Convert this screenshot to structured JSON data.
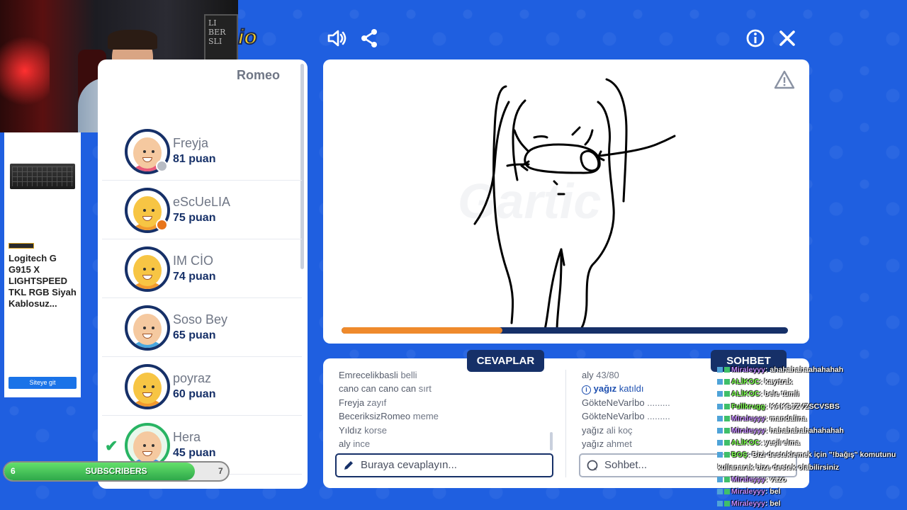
{
  "webcam": {
    "board_text": "LI BER SLI"
  },
  "ad": {
    "title": "Logitech G G915 X LIGHTSPEED TKL RGB Siyah Kablosuz...",
    "button": "Siteye git"
  },
  "logo": {
    "text": "io"
  },
  "players": {
    "partial_name": "Romeo",
    "list": [
      {
        "name": "Freyja",
        "score": "81 puan",
        "status": "gray",
        "shirt": "#e85a7a",
        "face": "#f5c9a0"
      },
      {
        "name": "eScUeLIA",
        "score": "75 puan",
        "status": "orange",
        "shirt": "#f29a2e",
        "face": "#f7c544"
      },
      {
        "name": "IM CİO",
        "score": "74 puan",
        "status": "",
        "shirt": "#f29a2e",
        "face": "#f7c544"
      },
      {
        "name": "Soso Bey",
        "score": "65 puan",
        "status": "",
        "shirt": "#4aa8e0",
        "face": "#f5c9a0"
      },
      {
        "name": "poyraz",
        "score": "60 puan",
        "status": "",
        "shirt": "#f29a2e",
        "face": "#f7c544"
      },
      {
        "name": "Hera",
        "score": "45 puan",
        "status": "",
        "shirt": "#3a8ee0",
        "face": "#f5c9a0",
        "guessed": true
      }
    ]
  },
  "canvas": {
    "watermark": "Gartic",
    "progress": 0.36
  },
  "tabs": {
    "answers": "CEVAPLAR",
    "chat": "SOHBET"
  },
  "answers": {
    "messages": [
      {
        "user": "Emrecelikbasli",
        "text": "belli"
      },
      {
        "user": "cano can cano can",
        "text": "sırt"
      },
      {
        "user": "Freyja",
        "text": "zayıf"
      },
      {
        "user": "BeceriksizRomeo",
        "text": "meme"
      },
      {
        "user": "Yıldız",
        "text": "korse"
      },
      {
        "user": "aly",
        "text": "ince"
      }
    ],
    "placeholder": "Buraya cevaplayın..."
  },
  "chat": {
    "messages": [
      {
        "user": "aly",
        "text": "43/80",
        "type": "normal"
      },
      {
        "user": "yağız",
        "text": "katıldı",
        "type": "join"
      },
      {
        "user": "GökteNeVarİbo",
        "text": ".........",
        "type": "normal"
      },
      {
        "user": "GökteNeVarİbo",
        "text": ".........",
        "type": "normal"
      },
      {
        "user": "yağız",
        "text": "ali koç",
        "type": "normal"
      },
      {
        "user": "yağız",
        "text": "ahmet",
        "type": "normal"
      }
    ],
    "placeholder": "Sohbet..."
  },
  "overlay_chat": [
    {
      "user": "Miraleyyy",
      "text": ": ahahahahaahahahah",
      "color": "#c58cff"
    },
    {
      "user": "ALİKOC",
      "text": ": kayıtrak",
      "color": "#7cff4f"
    },
    {
      "user": "ALİKOC",
      "text": ": bele tümli",
      "color": "#7cff4f"
    },
    {
      "user": "Fullkrugg",
      "text": ": KAKSJZVZSCVSBS",
      "color": "#7cff4f"
    },
    {
      "user": "Miraleyyy",
      "text": ": mandalina",
      "color": "#c58cff"
    },
    {
      "user": "Miraleyyy",
      "text": ": hahahahahahahahah",
      "color": "#c58cff"
    },
    {
      "user": "ALİKOC",
      "text": ": yeşil elma",
      "color": "#7cff4f"
    },
    {
      "user": "BOŞ",
      "text": ": Bizi desteklemek için \"!bağış\" komutunu",
      "color": "#7cff4f"
    },
    {
      "user": "",
      "text": "kullanarak bize destek olabilirsiniz",
      "color": "#ffffff"
    },
    {
      "user": "Miraleyyy",
      "text": ": vazo",
      "color": "#c58cff"
    },
    {
      "user": "Miraleyyy",
      "text": ": bel",
      "color": "#c58cff"
    },
    {
      "user": "Miraleyyy",
      "text": ": bel",
      "color": "#c58cff"
    }
  ],
  "subscribers": {
    "label": "SUBSCRIBERS",
    "current": "6",
    "goal": "7",
    "fraction": 0.85
  }
}
